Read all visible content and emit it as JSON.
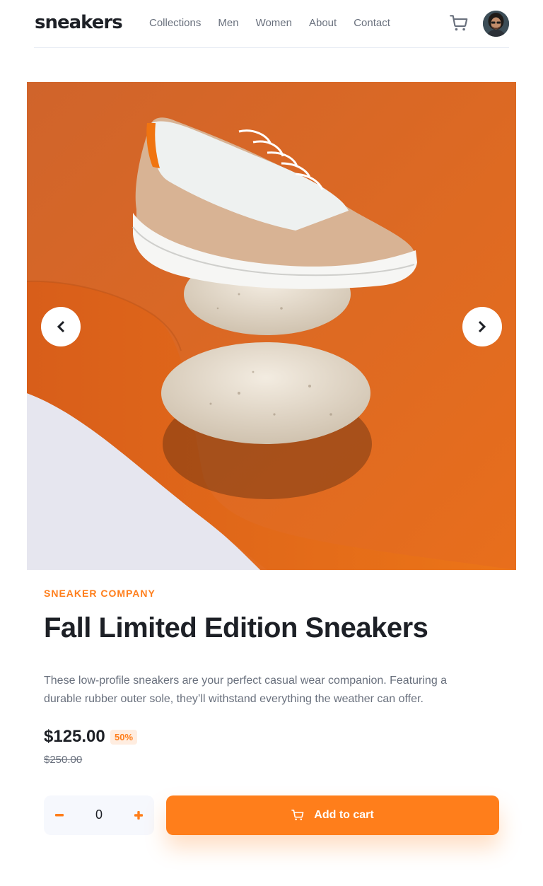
{
  "header": {
    "logo": "sneakers",
    "nav": [
      "Collections",
      "Men",
      "Women",
      "About",
      "Contact"
    ]
  },
  "product": {
    "company": "SNEAKER COMPANY",
    "title": "Fall Limited Edition Sneakers",
    "description": "These low-profile sneakers are your perfect casual wear companion. Featuring a durable rubber outer sole, they’ll withstand everything the weather can offer.",
    "price": "$125.00",
    "discount": "50%",
    "original_price": "$250.00"
  },
  "cart": {
    "quantity": "0",
    "add_label": "Add to cart"
  },
  "colors": {
    "accent": "#ff7e1b",
    "accent_pale": "#ffede0",
    "text_dark": "#1d2026",
    "text_muted": "#69707d"
  },
  "icons": [
    "cart-icon",
    "chevron-left-icon",
    "chevron-right-icon",
    "minus-icon",
    "plus-icon"
  ]
}
